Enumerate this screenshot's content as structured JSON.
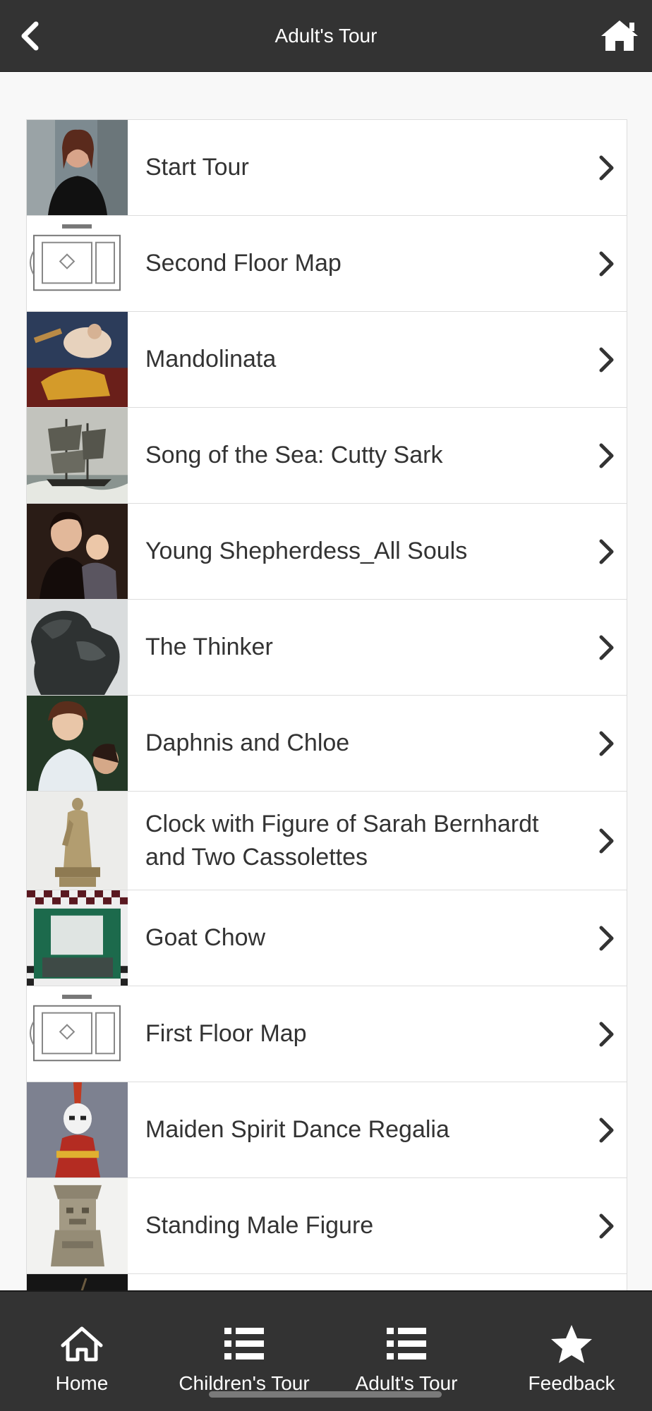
{
  "header": {
    "title": "Adult's Tour"
  },
  "list": {
    "items": [
      {
        "label": "Start Tour"
      },
      {
        "label": "Second Floor Map"
      },
      {
        "label": "Mandolinata"
      },
      {
        "label": "Song of the Sea: Cutty Sark"
      },
      {
        "label": "Young Shepherdess_All Souls"
      },
      {
        "label": "The Thinker"
      },
      {
        "label": "Daphnis and Chloe"
      },
      {
        "label": "Clock with Figure of Sarah Bernhardt and Two Cassolettes"
      },
      {
        "label": "Goat Chow"
      },
      {
        "label": "First Floor Map"
      },
      {
        "label": "Maiden Spirit Dance Regalia"
      },
      {
        "label": "Standing Male Figure"
      }
    ]
  },
  "tabbar": {
    "tabs": [
      {
        "label": "Home",
        "icon": "home-icon"
      },
      {
        "label": "Children's Tour",
        "icon": "list-icon"
      },
      {
        "label": "Adult's Tour",
        "icon": "list-icon"
      },
      {
        "label": "Feedback",
        "icon": "star-icon"
      }
    ]
  },
  "colors": {
    "bar_background": "#333333",
    "page_background": "#f8f8f8",
    "text": "#333333",
    "divider": "#dddddd"
  }
}
